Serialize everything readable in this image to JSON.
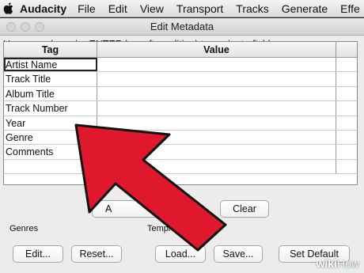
{
  "menubar": {
    "app_name": "Audacity",
    "items": [
      "File",
      "Edit",
      "View",
      "Transport",
      "Tracks",
      "Generate",
      "Effe"
    ]
  },
  "window": {
    "title": "Edit Metadata",
    "hint": "Use arrow keys (or ENTER key after editing) to navigate fields."
  },
  "grid": {
    "headers": {
      "tag": "Tag",
      "value": "Value"
    },
    "rows": [
      {
        "tag": "Artist Name",
        "value": ""
      },
      {
        "tag": "Track Title",
        "value": ""
      },
      {
        "tag": "Album Title",
        "value": ""
      },
      {
        "tag": "Track Number",
        "value": ""
      },
      {
        "tag": "Year",
        "value": ""
      },
      {
        "tag": "Genre",
        "value": ""
      },
      {
        "tag": "Comments",
        "value": ""
      },
      {
        "tag": "",
        "value": ""
      }
    ]
  },
  "buttons": {
    "add_partial": "A",
    "clear": "Clear",
    "edit": "Edit...",
    "reset": "Reset...",
    "load": "Load...",
    "save": "Save...",
    "set_default": "Set Default"
  },
  "sections": {
    "genres": "Genres",
    "template_partial": "Templ"
  },
  "watermark": {
    "wiki": "wiki",
    "how": "How"
  },
  "colors": {
    "arrow": "#e0182d",
    "arrow_outline": "#111111"
  }
}
